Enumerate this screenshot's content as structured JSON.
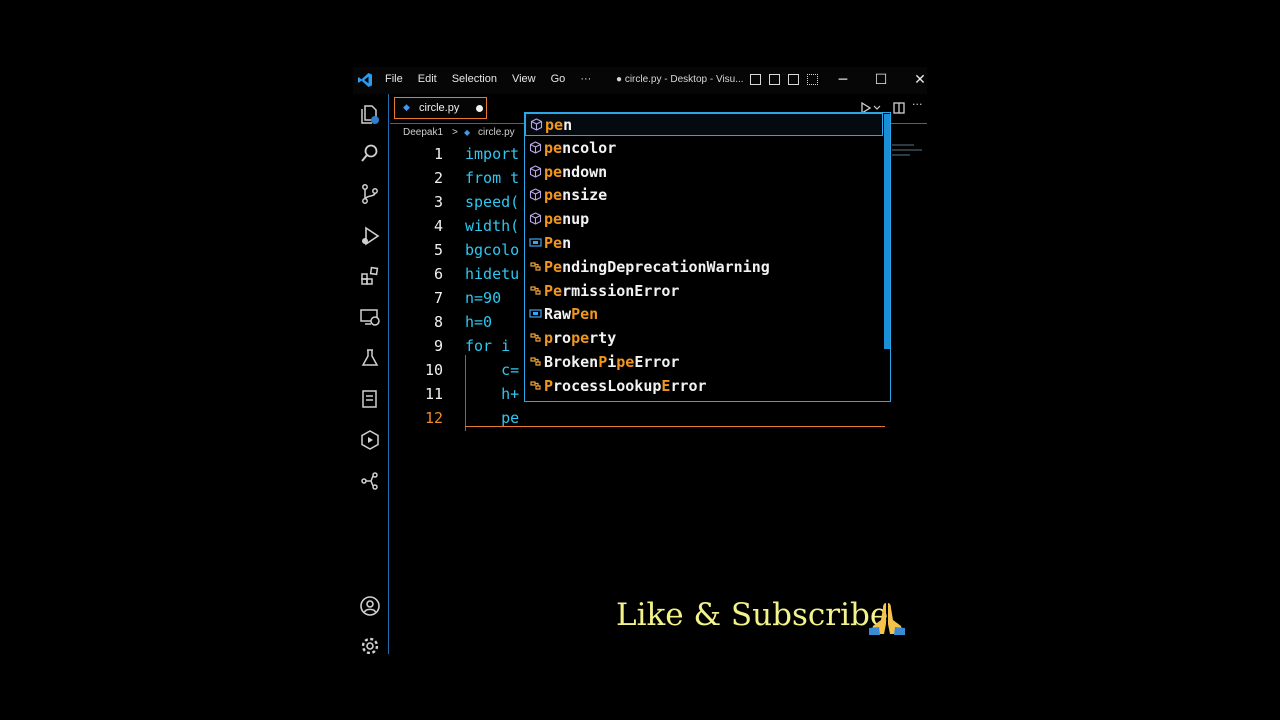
{
  "titlebar": {
    "menu": [
      "File",
      "Edit",
      "Selection",
      "View",
      "Go",
      "···"
    ],
    "window_title": "● circle.py - Desktop - Visu...",
    "window_controls": [
      "─",
      "☐",
      "✕"
    ]
  },
  "tab": {
    "label": "circle.py",
    "modified": true
  },
  "breadcrumb": [
    "Deepak1",
    ">",
    "circle.py"
  ],
  "editor": {
    "lines": [
      {
        "num": "1",
        "code": "import"
      },
      {
        "num": "2",
        "code": "from t"
      },
      {
        "num": "3",
        "code": "speed("
      },
      {
        "num": "4",
        "code": "width("
      },
      {
        "num": "5",
        "code": "bgcolo"
      },
      {
        "num": "6",
        "code": "hidetu"
      },
      {
        "num": "7",
        "code": "n=90"
      },
      {
        "num": "8",
        "code": "h=0"
      },
      {
        "num": "9",
        "code": "for i"
      },
      {
        "num": "10",
        "code": "    c="
      },
      {
        "num": "11",
        "code": "    h+"
      },
      {
        "num": "12",
        "code": "    pe"
      }
    ],
    "active_line": "12"
  },
  "suggestions": [
    {
      "kind": "method",
      "match": "pe",
      "rest": "n",
      "pre": ""
    },
    {
      "kind": "method",
      "match": "pe",
      "rest": "ncolor",
      "pre": ""
    },
    {
      "kind": "method",
      "match": "pe",
      "rest": "ndown",
      "pre": ""
    },
    {
      "kind": "method",
      "match": "pe",
      "rest": "nsize",
      "pre": ""
    },
    {
      "kind": "method",
      "match": "pe",
      "rest": "nup",
      "pre": ""
    },
    {
      "kind": "variable",
      "match": "Pe",
      "rest": "n",
      "pre": ""
    },
    {
      "kind": "class",
      "match": "Pe",
      "rest": "ndingDeprecationWarning",
      "pre": ""
    },
    {
      "kind": "class",
      "match": "Pe",
      "rest": "rmissionError",
      "pre": ""
    },
    {
      "kind": "variable",
      "match": "Pen",
      "rest": "",
      "pre": "Raw"
    },
    {
      "kind": "class",
      "match": "p",
      "rest": "ro",
      "pre": "",
      "extra_match": "pe",
      "tail": "rty"
    },
    {
      "kind": "class",
      "match": "Pi",
      "rest": "",
      "pre": "Broken"
    },
    {
      "kind": "class",
      "match": "P",
      "rest": "",
      "pre": ""
    }
  ],
  "overlay": {
    "text": "Like & Subscribe"
  },
  "colors": {
    "accent": "#2aa7e8",
    "match": "#f0961e",
    "code": "#2fc7f0",
    "active_line": "#f08a2a"
  }
}
